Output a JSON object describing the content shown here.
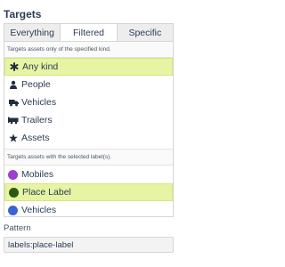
{
  "title": "Targets",
  "tabs": [
    {
      "label": "Everything"
    },
    {
      "label": "Filtered"
    },
    {
      "label": "Specific"
    }
  ],
  "kind_hint": "Targets assets only of the specified kind.",
  "kinds": [
    {
      "label": "Any kind",
      "icon": "asterisk-icon"
    },
    {
      "label": "People",
      "icon": "person-icon"
    },
    {
      "label": "Vehicles",
      "icon": "truck-icon"
    },
    {
      "label": "Trailers",
      "icon": "trailer-icon"
    },
    {
      "label": "Assets",
      "icon": "star-icon"
    }
  ],
  "label_hint": "Targets assets with the selected label(s).",
  "labels": [
    {
      "label": "Mobiles",
      "color": "#9b3fd1"
    },
    {
      "label": "Place Label",
      "color": "#2d5a12"
    },
    {
      "label": "Vehicles",
      "color": "#3a63d6"
    }
  ],
  "selected_color": "#e6f4a4",
  "pattern": {
    "label": "Pattern",
    "value": "labels:place-label"
  }
}
